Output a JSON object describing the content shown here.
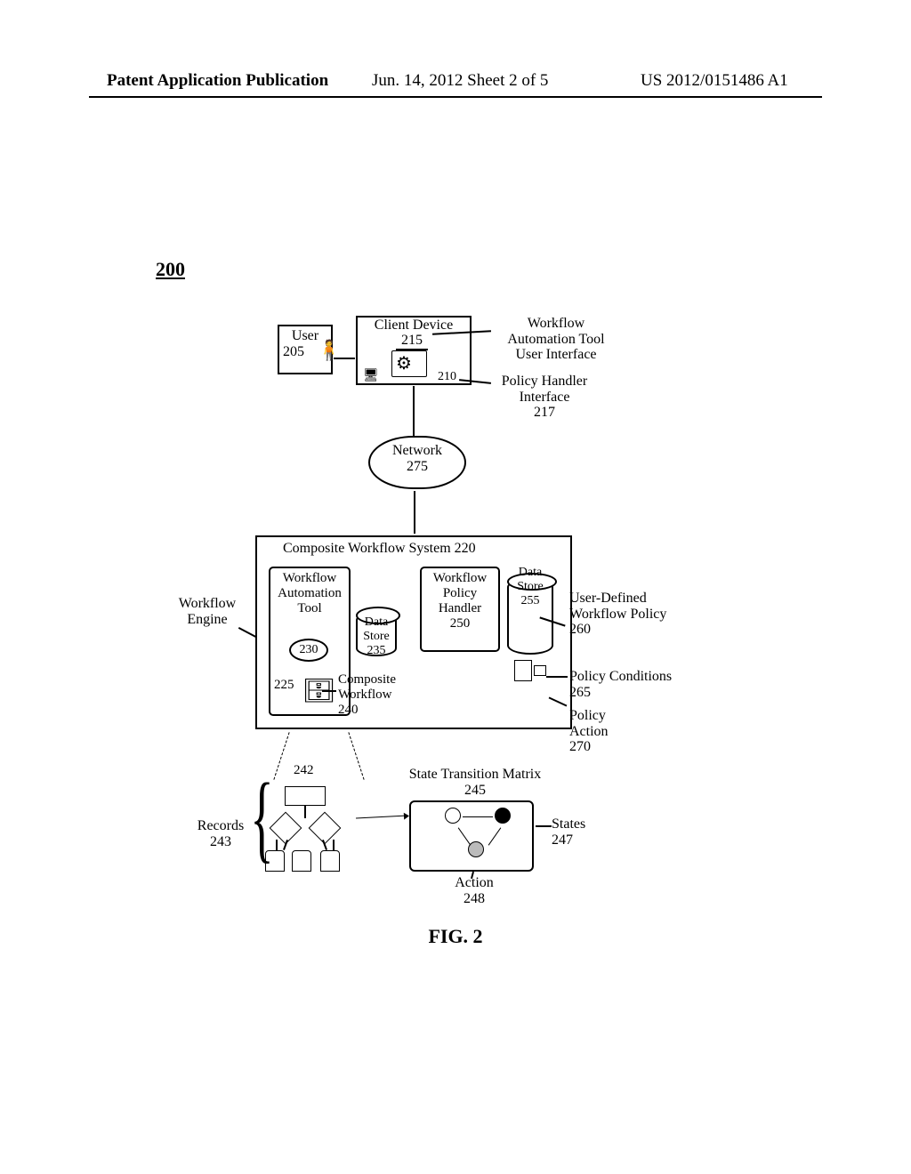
{
  "header": {
    "left": "Patent Application Publication",
    "mid": "Jun. 14, 2012  Sheet 2 of 5",
    "right": "US 2012/0151486 A1"
  },
  "figure_number": "200",
  "user": {
    "label": "User",
    "num": "205"
  },
  "client_device": {
    "title": "Client Device",
    "gear_num": "215",
    "box_num": "210"
  },
  "callouts": {
    "wat_ui": "Workflow\nAutomation Tool\nUser Interface",
    "ph_int": "Policy Handler\nInterface\n217",
    "wf_engine": "Workflow\nEngine",
    "composite_wf": "Composite\nWorkflow\n240",
    "udwp": "User-Defined\nWorkflow Policy\n260",
    "pc": "Policy Conditions\n265",
    "pa": "Policy\nAction\n270",
    "records": "Records\n243",
    "states": "States\n247",
    "action": "Action\n248"
  },
  "network": {
    "label": "Network",
    "num": "275"
  },
  "system": {
    "title": "Composite Workflow System   220",
    "wat": {
      "title": "Workflow\nAutomation\nTool",
      "num230": "230",
      "num225": "225"
    },
    "ds235": {
      "title": "Data\nStore\n235"
    },
    "wph": {
      "title": "Workflow\nPolicy\nHandler\n250"
    },
    "ds255": {
      "title": "Data\nStore\n255"
    }
  },
  "expansion": {
    "num242": "242"
  },
  "stm": {
    "title": "State Transition Matrix\n245"
  },
  "fig_caption": "FIG. 2"
}
